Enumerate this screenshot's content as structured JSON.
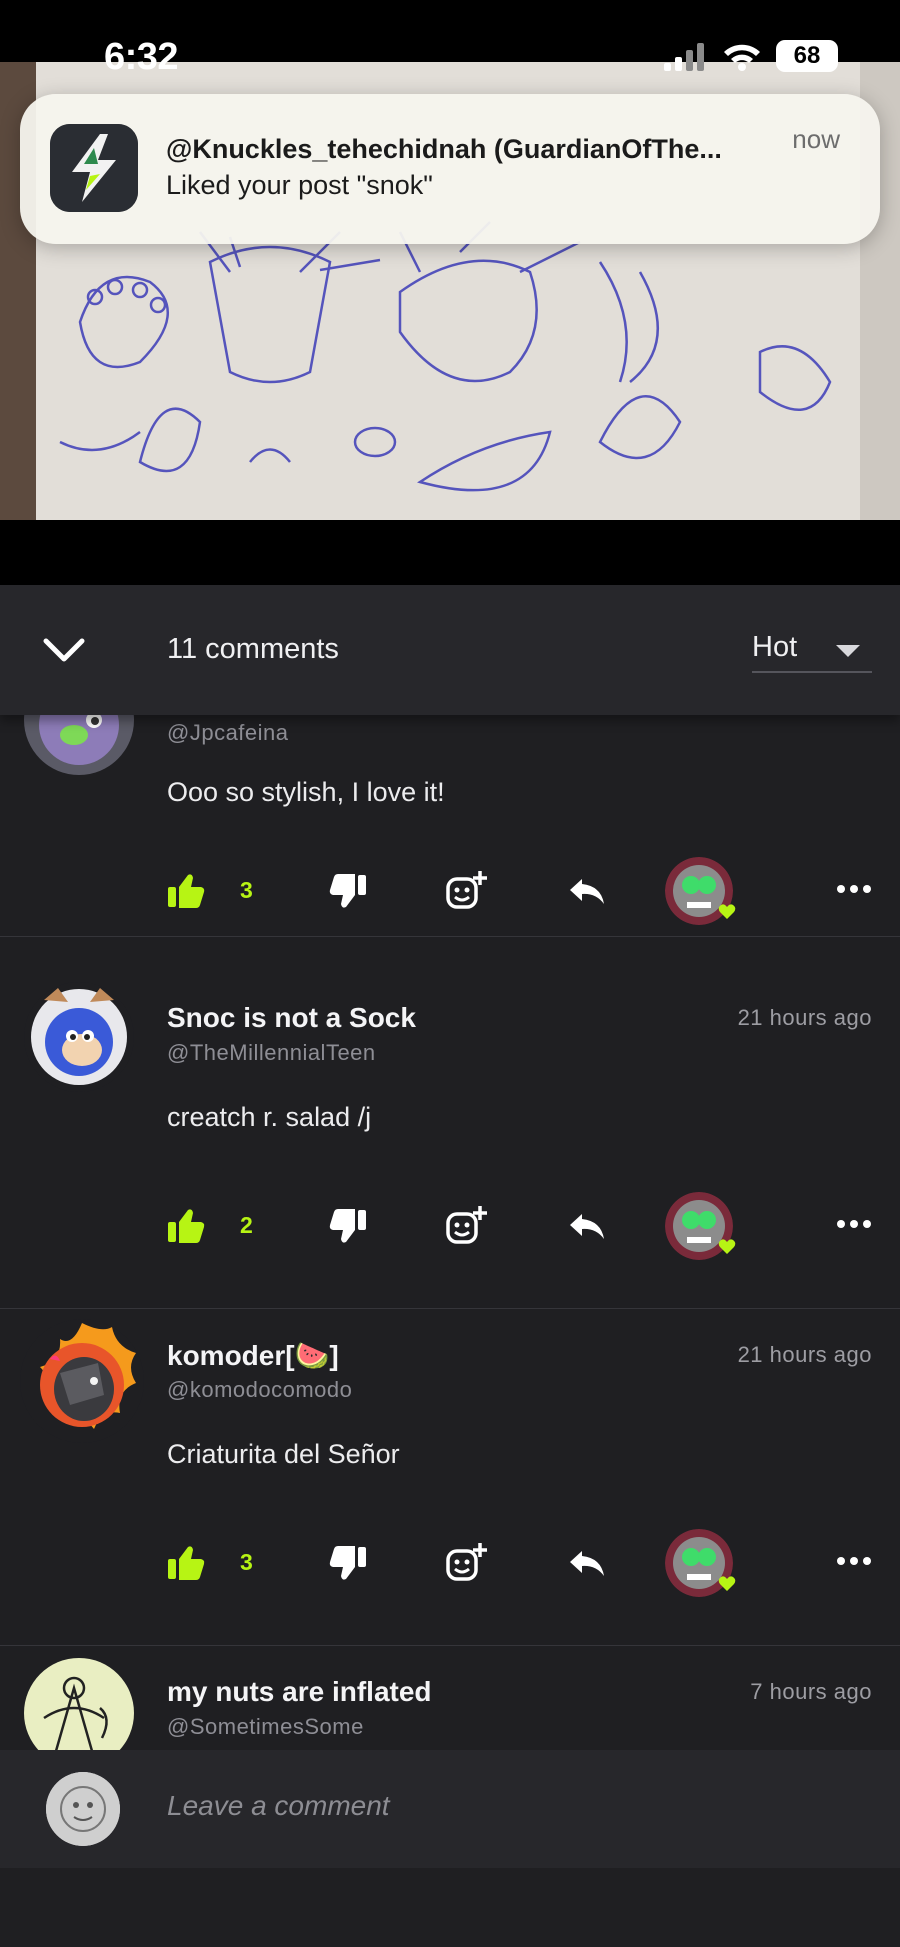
{
  "status_bar": {
    "time": "6:32",
    "battery": "68"
  },
  "notification": {
    "title": "@Knuckles_tehechidnah (GuardianOfThe...",
    "body": "Liked your post \"snok\"",
    "time": "now"
  },
  "header": {
    "comment_count": "11 comments",
    "sort_label": "Hot"
  },
  "comments": [
    {
      "name": "",
      "handle": "@Jpcafeina",
      "time": "",
      "text": "Ooo so stylish, I love it!",
      "likes": "3"
    },
    {
      "name": "Snoc is not a Sock",
      "handle": "@TheMillennialTeen",
      "time": "21 hours ago",
      "text": "creatch r. salad /j",
      "likes": "2"
    },
    {
      "name": "komoder[🍉]",
      "handle": "@komodocomodo",
      "time": "21 hours ago",
      "text": "Criaturita del Señor",
      "likes": "3"
    },
    {
      "name": "my nuts are inflated",
      "handle": "@SometimesSome",
      "time": "7 hours ago",
      "text": "",
      "likes": ""
    }
  ],
  "compose": {
    "placeholder": "Leave a comment"
  },
  "icons": {
    "like": "thumbs-up-icon",
    "dislike": "thumbs-down-icon",
    "react": "add-emoji-icon",
    "reply": "reply-icon",
    "more": "more-dots-icon",
    "collapse": "chevron-down-icon"
  },
  "colors": {
    "accent": "#b7f414",
    "background": "#1f1f22",
    "header": "#27272b"
  }
}
